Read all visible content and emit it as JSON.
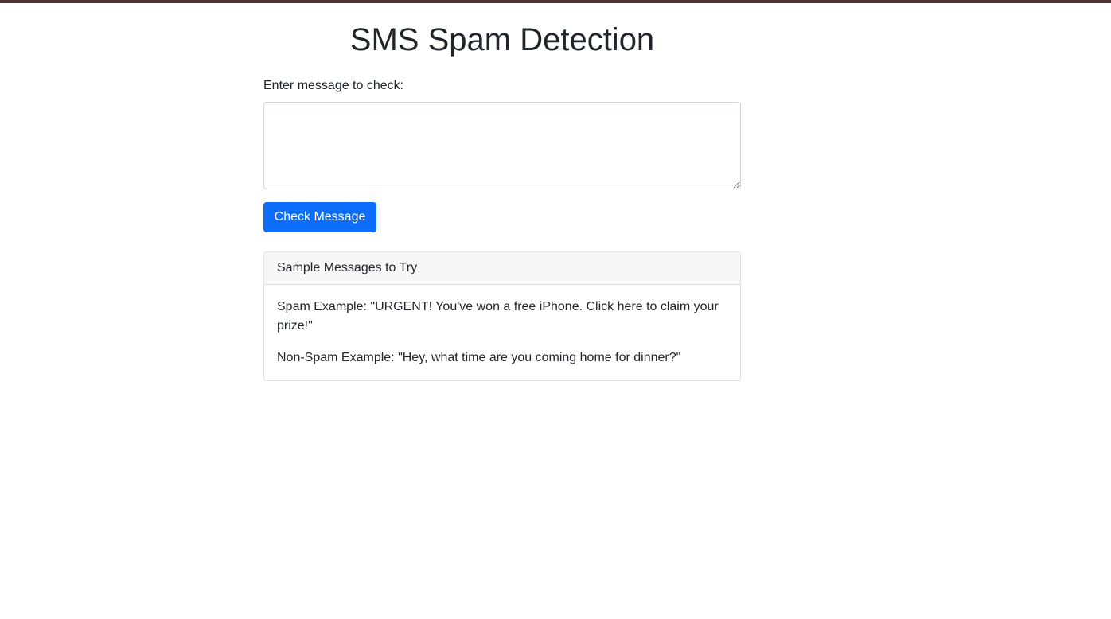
{
  "page": {
    "title": "SMS Spam Detection"
  },
  "form": {
    "label": "Enter message to check:",
    "message_value": "",
    "submit_label": "Check Message"
  },
  "samples": {
    "header": "Sample Messages to Try",
    "spam": "Spam Example: \"URGENT! You've won a free iPhone. Click here to claim your prize!\"",
    "non_spam": "Non-Spam Example: \"Hey, what time are you coming home for dinner?\""
  },
  "colors": {
    "accent": "#0d6efd",
    "top_bar": "#4a3330",
    "text": "#212529",
    "border": "#dee2e6",
    "card_header_bg": "#f7f7f7"
  }
}
